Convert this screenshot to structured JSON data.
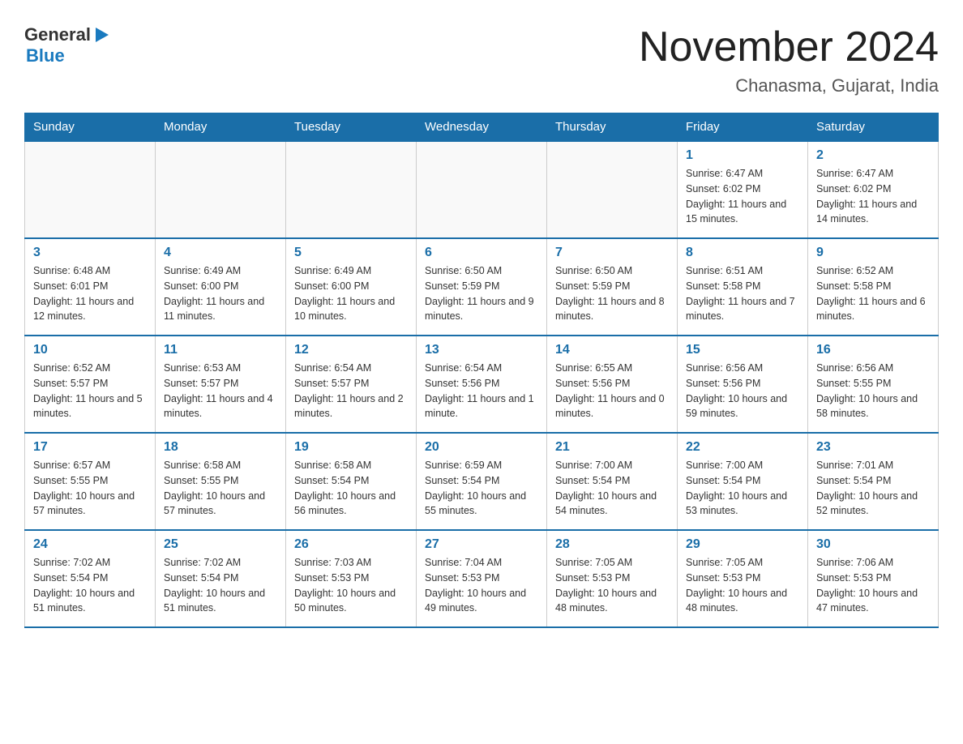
{
  "header": {
    "logo_general": "General",
    "logo_blue": "Blue",
    "calendar_title": "November 2024",
    "calendar_subtitle": "Chanasma, Gujarat, India"
  },
  "days_of_week": [
    "Sunday",
    "Monday",
    "Tuesday",
    "Wednesday",
    "Thursday",
    "Friday",
    "Saturday"
  ],
  "weeks": [
    [
      {
        "day": "",
        "info": ""
      },
      {
        "day": "",
        "info": ""
      },
      {
        "day": "",
        "info": ""
      },
      {
        "day": "",
        "info": ""
      },
      {
        "day": "",
        "info": ""
      },
      {
        "day": "1",
        "info": "Sunrise: 6:47 AM\nSunset: 6:02 PM\nDaylight: 11 hours and 15 minutes."
      },
      {
        "day": "2",
        "info": "Sunrise: 6:47 AM\nSunset: 6:02 PM\nDaylight: 11 hours and 14 minutes."
      }
    ],
    [
      {
        "day": "3",
        "info": "Sunrise: 6:48 AM\nSunset: 6:01 PM\nDaylight: 11 hours and 12 minutes."
      },
      {
        "day": "4",
        "info": "Sunrise: 6:49 AM\nSunset: 6:00 PM\nDaylight: 11 hours and 11 minutes."
      },
      {
        "day": "5",
        "info": "Sunrise: 6:49 AM\nSunset: 6:00 PM\nDaylight: 11 hours and 10 minutes."
      },
      {
        "day": "6",
        "info": "Sunrise: 6:50 AM\nSunset: 5:59 PM\nDaylight: 11 hours and 9 minutes."
      },
      {
        "day": "7",
        "info": "Sunrise: 6:50 AM\nSunset: 5:59 PM\nDaylight: 11 hours and 8 minutes."
      },
      {
        "day": "8",
        "info": "Sunrise: 6:51 AM\nSunset: 5:58 PM\nDaylight: 11 hours and 7 minutes."
      },
      {
        "day": "9",
        "info": "Sunrise: 6:52 AM\nSunset: 5:58 PM\nDaylight: 11 hours and 6 minutes."
      }
    ],
    [
      {
        "day": "10",
        "info": "Sunrise: 6:52 AM\nSunset: 5:57 PM\nDaylight: 11 hours and 5 minutes."
      },
      {
        "day": "11",
        "info": "Sunrise: 6:53 AM\nSunset: 5:57 PM\nDaylight: 11 hours and 4 minutes."
      },
      {
        "day": "12",
        "info": "Sunrise: 6:54 AM\nSunset: 5:57 PM\nDaylight: 11 hours and 2 minutes."
      },
      {
        "day": "13",
        "info": "Sunrise: 6:54 AM\nSunset: 5:56 PM\nDaylight: 11 hours and 1 minute."
      },
      {
        "day": "14",
        "info": "Sunrise: 6:55 AM\nSunset: 5:56 PM\nDaylight: 11 hours and 0 minutes."
      },
      {
        "day": "15",
        "info": "Sunrise: 6:56 AM\nSunset: 5:56 PM\nDaylight: 10 hours and 59 minutes."
      },
      {
        "day": "16",
        "info": "Sunrise: 6:56 AM\nSunset: 5:55 PM\nDaylight: 10 hours and 58 minutes."
      }
    ],
    [
      {
        "day": "17",
        "info": "Sunrise: 6:57 AM\nSunset: 5:55 PM\nDaylight: 10 hours and 57 minutes."
      },
      {
        "day": "18",
        "info": "Sunrise: 6:58 AM\nSunset: 5:55 PM\nDaylight: 10 hours and 57 minutes."
      },
      {
        "day": "19",
        "info": "Sunrise: 6:58 AM\nSunset: 5:54 PM\nDaylight: 10 hours and 56 minutes."
      },
      {
        "day": "20",
        "info": "Sunrise: 6:59 AM\nSunset: 5:54 PM\nDaylight: 10 hours and 55 minutes."
      },
      {
        "day": "21",
        "info": "Sunrise: 7:00 AM\nSunset: 5:54 PM\nDaylight: 10 hours and 54 minutes."
      },
      {
        "day": "22",
        "info": "Sunrise: 7:00 AM\nSunset: 5:54 PM\nDaylight: 10 hours and 53 minutes."
      },
      {
        "day": "23",
        "info": "Sunrise: 7:01 AM\nSunset: 5:54 PM\nDaylight: 10 hours and 52 minutes."
      }
    ],
    [
      {
        "day": "24",
        "info": "Sunrise: 7:02 AM\nSunset: 5:54 PM\nDaylight: 10 hours and 51 minutes."
      },
      {
        "day": "25",
        "info": "Sunrise: 7:02 AM\nSunset: 5:54 PM\nDaylight: 10 hours and 51 minutes."
      },
      {
        "day": "26",
        "info": "Sunrise: 7:03 AM\nSunset: 5:53 PM\nDaylight: 10 hours and 50 minutes."
      },
      {
        "day": "27",
        "info": "Sunrise: 7:04 AM\nSunset: 5:53 PM\nDaylight: 10 hours and 49 minutes."
      },
      {
        "day": "28",
        "info": "Sunrise: 7:05 AM\nSunset: 5:53 PM\nDaylight: 10 hours and 48 minutes."
      },
      {
        "day": "29",
        "info": "Sunrise: 7:05 AM\nSunset: 5:53 PM\nDaylight: 10 hours and 48 minutes."
      },
      {
        "day": "30",
        "info": "Sunrise: 7:06 AM\nSunset: 5:53 PM\nDaylight: 10 hours and 47 minutes."
      }
    ]
  ]
}
